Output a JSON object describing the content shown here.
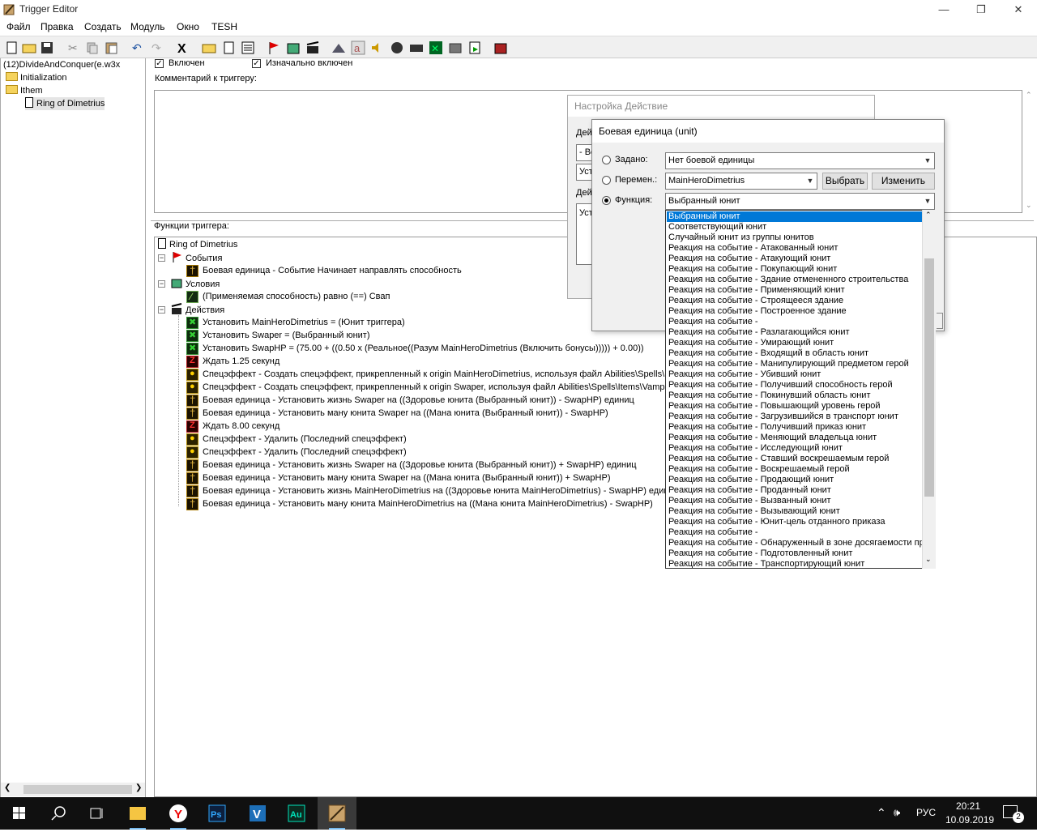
{
  "window": {
    "title": "Trigger Editor",
    "buttons": [
      "—",
      "❐",
      "✕"
    ]
  },
  "menu": [
    "Файл",
    "Правка",
    "Создать",
    "Модуль",
    "Окно",
    "TESH"
  ],
  "tree": {
    "root": "(12)DivideAndConquer(e.w3x",
    "items": [
      "Initialization",
      "Ithem",
      "Ring of  Dimetrius"
    ]
  },
  "trigger": {
    "enabled_label": "Включен",
    "initially_enabled_label": "Изначально включен",
    "comment_label": "Комментарий к триггеру:",
    "functions_label": "Функции триггера:",
    "name": "Ring of  Dimetrius",
    "events_label": "События",
    "event": "Боевая единица - Событие Начинает направлять способность",
    "conditions_label": "Условия",
    "condition": "(Применяемая способность) равно (==) Свап",
    "actions_label": "Действия",
    "actions": [
      {
        "icon": "set",
        "text": "Установить MainHeroDimetrius = (Юнит триггера)"
      },
      {
        "icon": "set",
        "text": "Установить Swaper = (Выбранный юнит)"
      },
      {
        "icon": "set",
        "text": "Установить SwapHP = (75.00 + ((0.50 x (Реальное((Разум MainHeroDimetrius (Включить бонусы))))) + 0.00))"
      },
      {
        "icon": "wait",
        "text": "Ждать 1.25 секунд"
      },
      {
        "icon": "fx",
        "text": "Спецэффект - Создать спецэффект, прикрепленный к origin MainHeroDimetrius, используя файл Abilities\\Spells\\Items\\"
      },
      {
        "icon": "fx",
        "text": "Спецэффект - Создать спецэффект, прикрепленный к origin Swaper, используя файл Abilities\\Spells\\Items\\Vampiric"
      },
      {
        "icon": "unit",
        "text": "Боевая единица - Установить жизнь Swaper на ((Здоровье юнита (Выбранный юнит)) - SwapHP) единиц"
      },
      {
        "icon": "unit",
        "text": "Боевая единица - Установить ману юнита Swaper на ((Мана юнита (Выбранный юнит)) - SwapHP)"
      },
      {
        "icon": "wait",
        "text": "Ждать 8.00 секунд"
      },
      {
        "icon": "fx",
        "text": "Спецэффект - Удалить (Последний спецэффект)"
      },
      {
        "icon": "fx",
        "text": "Спецэффект - Удалить (Последний спецэффект)"
      },
      {
        "icon": "unit",
        "text": "Боевая единица - Установить жизнь Swaper на ((Здоровье юнита (Выбранный юнит)) + SwapHP) единиц"
      },
      {
        "icon": "unit",
        "text": "Боевая единица - Установить ману юнита Swaper на ((Мана юнита (Выбранный юнит)) + SwapHP)"
      },
      {
        "icon": "unit",
        "text": "Боевая единица - Установить жизнь MainHeroDimetrius на ((Здоровье юнита MainHeroDimetrius) - SwapHP) единиц"
      },
      {
        "icon": "unit",
        "text": "Боевая единица - Установить ману юнита MainHeroDimetrius на ((Мана юнита MainHeroDimetrius) - SwapHP)"
      }
    ]
  },
  "dialog_back": {
    "title": "Настройка Действие",
    "label1": "Дей",
    "field1": "- Во",
    "field2": "Уст",
    "label2": "Дей",
    "field3": "Уст"
  },
  "dialog_front": {
    "title": "Боевая единица (unit)",
    "preset_label": "Задано:",
    "preset_value": "Нет боевой единицы",
    "variable_label": "Перемен.:",
    "variable_value": "MainHeroDimetrius",
    "choose_button": "Выбрать",
    "edit_button": "Изменить",
    "function_label": "Функция:",
    "function_value": "Выбранный юнит",
    "selected_radio": "function"
  },
  "dropdown": {
    "selected_index": 0,
    "items": [
      "Выбранный юнит",
      "Соответствующий юнит",
      "Случайный юнит из группы юнитов",
      "Реакция на событие - Атакованный юнит",
      "Реакция на событие - Атакующий юнит",
      "Реакция на событие - Покупающий юнит",
      "Реакция на событие - Здание отмененного строительства",
      "Реакция на событие - Применяющий юнит",
      "Реакция на событие - Строящееся здание",
      "Реакция на событие - Построенное здание",
      "Реакция на событие -",
      "Реакция на событие - Разлагающийся юнит",
      "Реакция на событие - Умирающий юнит",
      "Реакция на событие - Входящий в область юнит",
      "Реакция на событие - Манипулирующий предметом герой",
      "Реакция на событие - Убивший юнит",
      "Реакция на событие - Получивший способность герой",
      "Реакция на событие - Покинувший область юнит",
      "Реакция на событие - Повышающий уровень герой",
      "Реакция на событие - Загрузившийся в транспорт юнит",
      "Реакция на событие - Получивший приказ юнит",
      "Реакция на событие - Меняющий владельца юнит",
      "Реакция на событие - Исследующий юнит",
      "Реакция на событие - Ставший воскрешаемым герой",
      "Реакция на событие - Воскрешаемый герой",
      "Реакция на событие - Продающий юнит",
      "Реакция на событие - Проданный юнит",
      "Реакция на событие - Вызванный юнит",
      "Реакция на событие - Вызывающий юнит",
      "Реакция на событие - Юнит-цель отданного приказа",
      "Реакция на событие -",
      "Реакция на событие - Обнаруженный в зоне досягаемости пр",
      "Реакция на событие - Подготовленный юнит",
      "Реакция на событие - Транспортирующий юнит"
    ]
  },
  "taskbar": {
    "lang": "РУС",
    "time": "20:21",
    "date": "10.09.2019",
    "notifications": "2",
    "apps": [
      "start-icon",
      "search-icon",
      "task-view-icon",
      "file-explorer-icon",
      "yandex-browser-icon",
      "photoshop-icon",
      "vegas-icon",
      "audition-icon",
      "world-editor-icon"
    ]
  },
  "colors": {
    "selection": "#0078d7",
    "taskbar": "#101010",
    "folder": "#f5d35d"
  }
}
